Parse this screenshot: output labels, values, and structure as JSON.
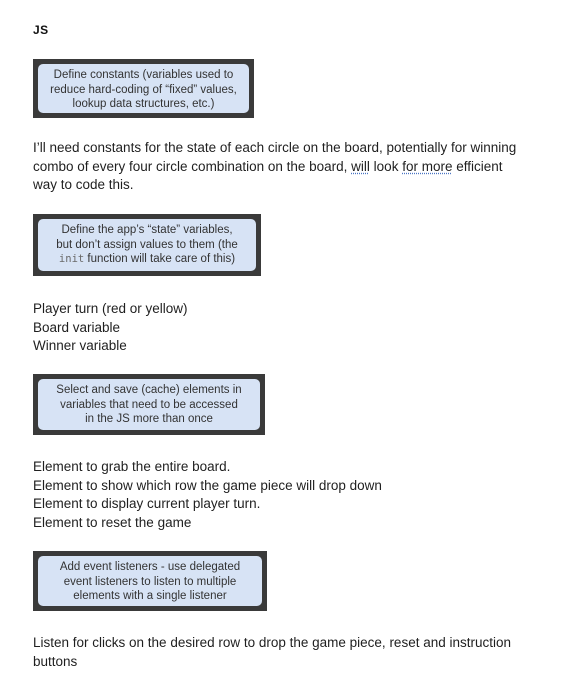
{
  "heading": "JS",
  "sections": [
    {
      "callout": [
        "Define constants (variables used to",
        "reduce hard-coding of “fixed” values,",
        "lookup data structures, etc.)"
      ],
      "text": {
        "line1": "I’ll need constants for the state of each circle on the board, potentially for winning",
        "line2_a": "combo of every four circle combination on the board, ",
        "line2_will": "will",
        "line2_b": " look ",
        "line2_formore": "for more",
        "line2_c": " efficient",
        "line3": "way to code this."
      }
    },
    {
      "callout": {
        "line1": "Define the app’s “state” variables,",
        "line2": "but don’t assign values to them (the",
        "line3_code": "init",
        "line3_rest": " function will take care of this)"
      },
      "text": [
        "Player turn (red or yellow)",
        "Board variable",
        "Winner variable"
      ]
    },
    {
      "callout": [
        "Select and save (cache) elements in",
        "variables that need to be accessed",
        "in the JS more than once"
      ],
      "text": [
        "Element to grab the entire board.",
        "Element to show which row the game piece will drop down",
        "Element to display current player turn.",
        "Element to reset the game"
      ]
    },
    {
      "callout": [
        "Add event listeners - use delegated",
        "event listeners to listen to multiple",
        "elements with a single listener"
      ],
      "text": [
        "Listen for clicks on the desired row to drop the game piece, reset and instruction",
        "buttons"
      ]
    }
  ]
}
